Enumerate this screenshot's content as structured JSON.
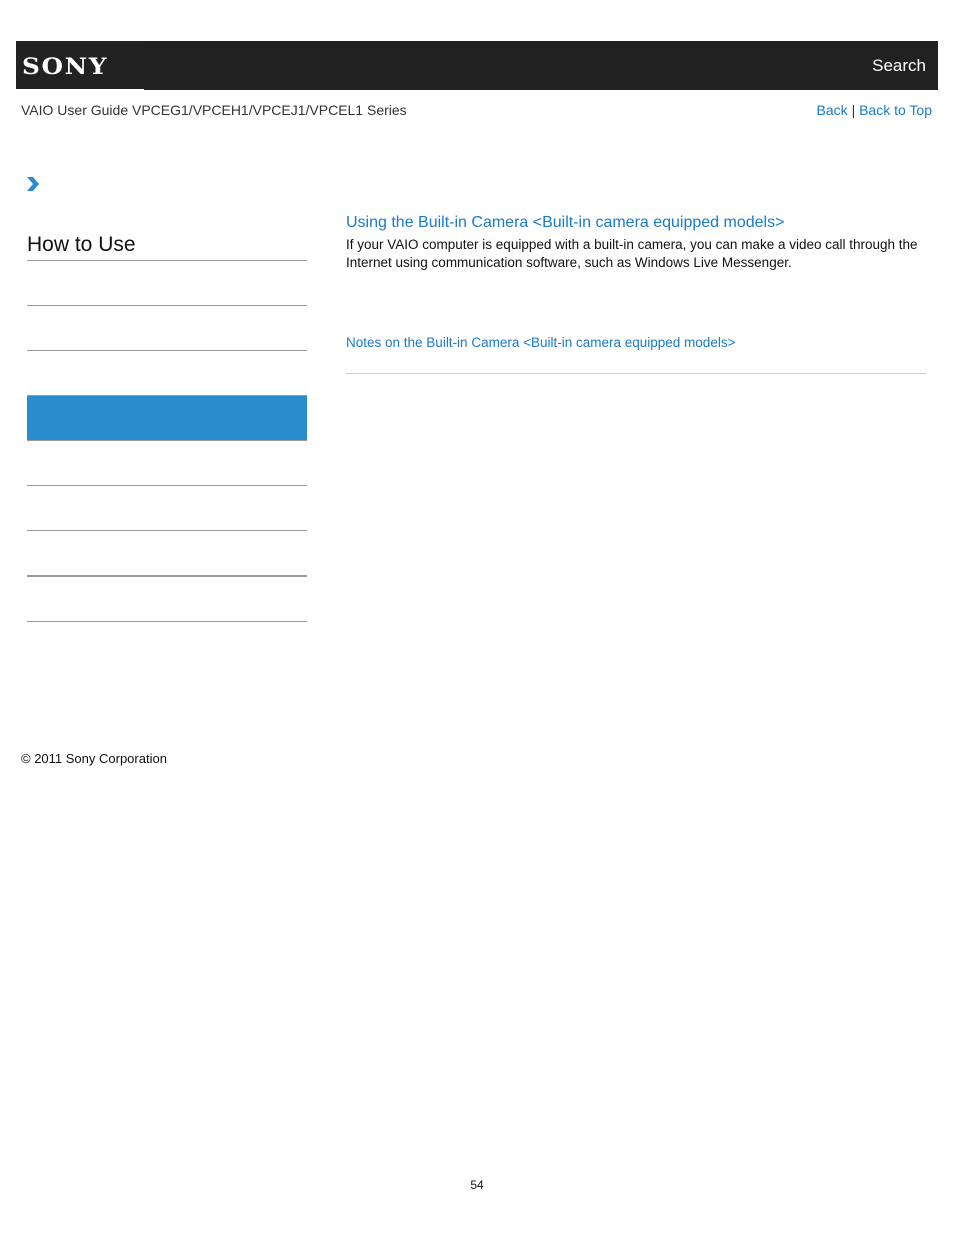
{
  "header": {
    "logo": "SONY",
    "search_label": "Search"
  },
  "subheader": {
    "guide_title": "VAIO User Guide VPCEG1/VPCEH1/VPCEJ1/VPCEL1 Series",
    "back_label": "Back",
    "separator": "|",
    "back_to_top_label": "Back to Top"
  },
  "sidebar": {
    "breadcrumb_icon": "chevron-right-icon",
    "title": "How to Use",
    "items": [
      {
        "label": "",
        "active": false
      },
      {
        "label": "",
        "active": false
      },
      {
        "label": "",
        "active": false
      },
      {
        "label": "",
        "active": true
      },
      {
        "label": "",
        "active": false
      },
      {
        "label": "",
        "active": false
      },
      {
        "label": "",
        "active": false
      },
      {
        "label": "",
        "active": false
      },
      {
        "label": "",
        "active": false
      }
    ],
    "active_color": "#2a8ccd"
  },
  "main": {
    "topics": [
      {
        "title": "Using the Built-in Camera <Built-in camera equipped models>",
        "description": "If your VAIO computer is equipped with a built-in camera, you can make a video call through the Internet using communication software, such as Windows Live Messenger."
      },
      {
        "title": "Notes on the Built-in Camera <Built-in camera equipped models>"
      }
    ],
    "link_color": "#1a7acb"
  },
  "footer": {
    "copyright": "© 2011 Sony Corporation",
    "page_number": "54"
  }
}
